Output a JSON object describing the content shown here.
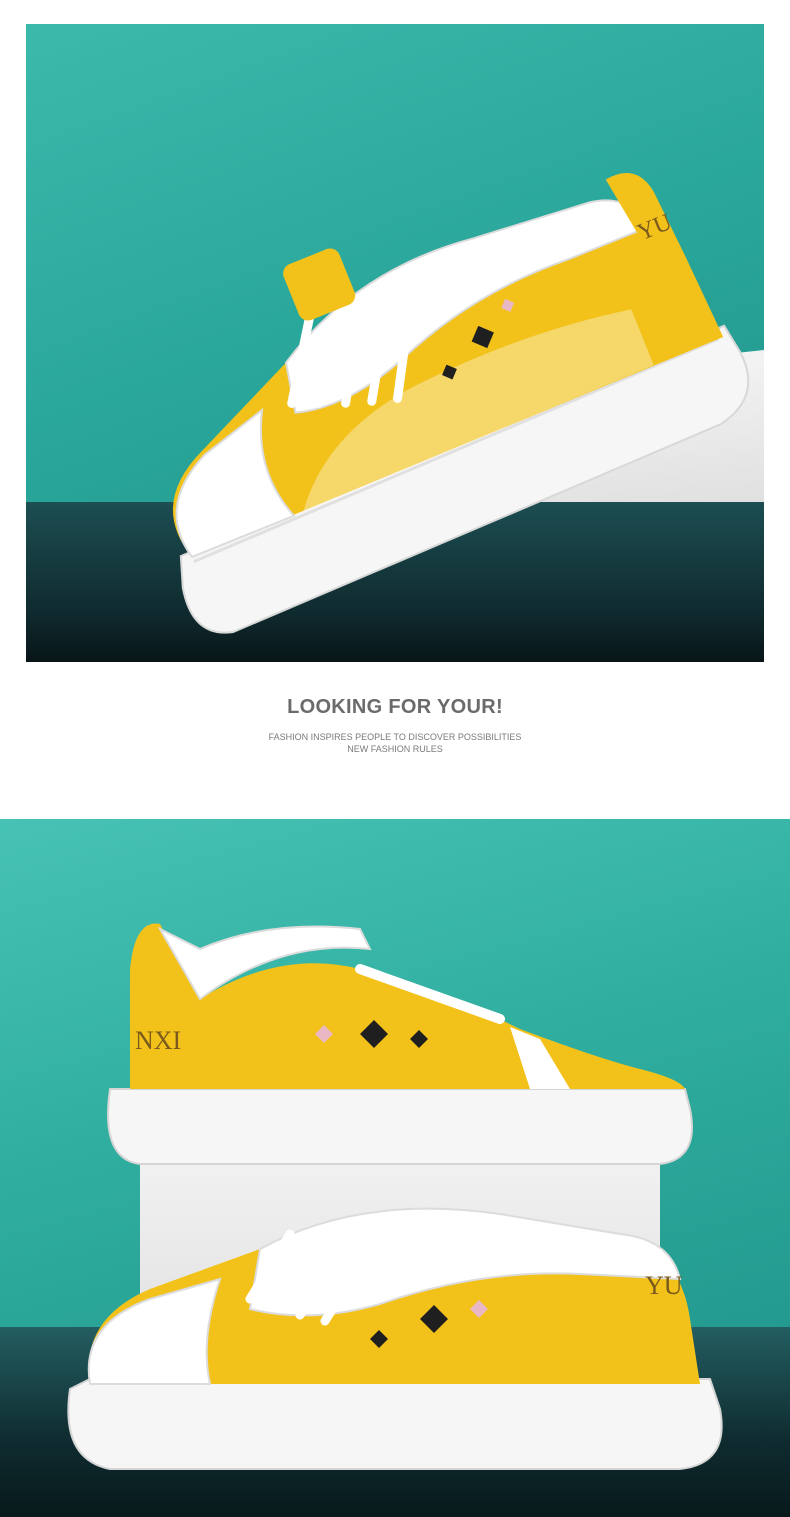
{
  "headline": "LOOKING FOR YOUR!",
  "subline_1": "FASHION INSPIRES PEOPLE TO DISCOVER POSSIBILITIES",
  "subline_2": "NEW FASHION RULES",
  "brand_mark_heel": "YU",
  "brand_mark_side": "NXI",
  "colors": {
    "accent_yellow": "#f2c21b",
    "background_teal": "#2faa9e",
    "sole_white": "#f7f7f7",
    "text_gray": "#6b6b6b"
  }
}
